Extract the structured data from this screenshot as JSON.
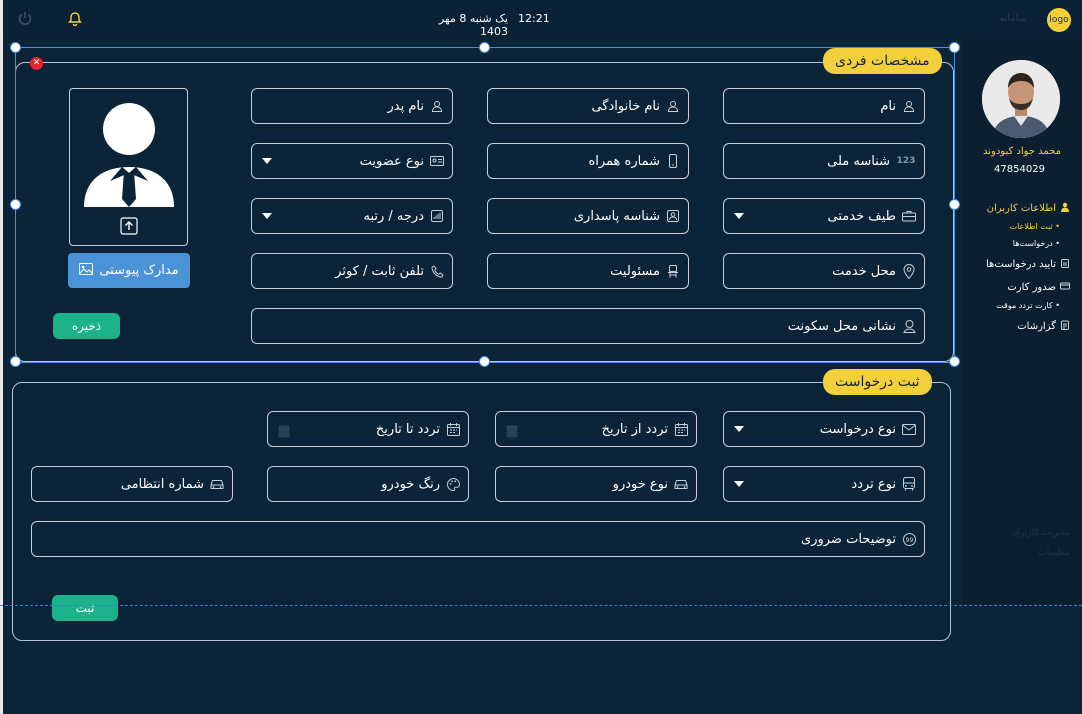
{
  "header": {
    "time": "12:21",
    "date": "یک شنبه 8 مهر 1403",
    "logo_label": "logo",
    "app_name": "سامانه"
  },
  "sidebar": {
    "user_name": "محمد جواد کبودوند",
    "user_id": "47854029",
    "items": [
      {
        "label": "اطلاعات کاربران",
        "icon": "user-icon",
        "active": true
      },
      {
        "label": "ثبت اطلاعات",
        "sub": true,
        "active": true
      },
      {
        "label": "درخواست‌ها",
        "sub": true
      },
      {
        "label": "تایید درخواست‌ها",
        "icon": "clipboard-icon"
      },
      {
        "label": "صدور کارت",
        "icon": "card-icon"
      },
      {
        "label": "کارت تردد موقت",
        "sub": true
      },
      {
        "label": "گزارشات",
        "icon": "report-icon"
      }
    ],
    "dim_items": [
      "مدیریت کاربران",
      "تنظیمات"
    ]
  },
  "personal": {
    "title": "مشخصات فردی",
    "fields": {
      "name": "نام",
      "family": "نام خانوادگی",
      "father": "نام پدر",
      "national_id": "شناسه ملی",
      "mobile": "شماره همراه",
      "membership": "نوع عضویت",
      "service_range": "طیف خدمتی",
      "guard_id": "شناسه پاسداری",
      "rank": "درجه / رتبه",
      "service_place": "محل خدمت",
      "responsibility": "مسئولیت",
      "phone": "تلفن ثابت / کوثر",
      "address": "نشانی محل سکونت"
    },
    "docs_button": "مدارک پیوستی",
    "save_button": "ذخیره"
  },
  "request": {
    "title": "ثبت درخواست",
    "fields": {
      "request_type": "نوع درخواست",
      "from_date": "تردد از تاریخ",
      "to_date": "تردد تا تاریخ",
      "traffic_type": "نوع تردد",
      "vehicle_type": "نوع خودرو",
      "vehicle_color": "رنگ خودرو",
      "plate": "شماره انتظامی",
      "description": "توضیحات ضروری"
    },
    "submit_button": "ثبت"
  },
  "colors": {
    "background": "#0c2438",
    "accent": "#f2d03b",
    "primary_button": "#4a93d6",
    "success_button": "#1db38a",
    "selection": "#4a90e2"
  }
}
